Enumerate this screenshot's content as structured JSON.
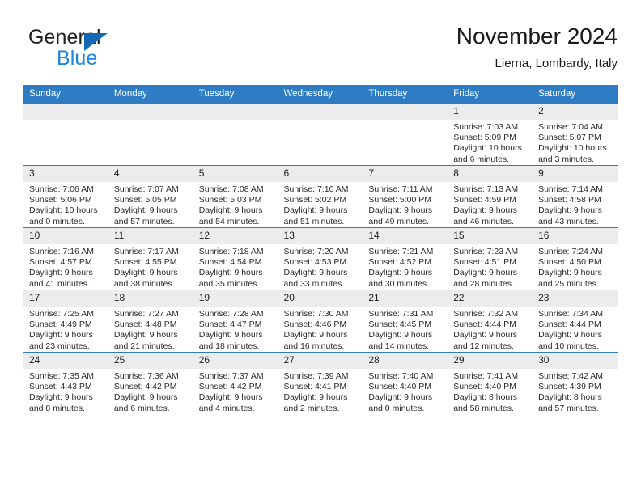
{
  "brand": {
    "name_part1": "General",
    "name_part2": "Blue",
    "logo_icon": "blue-triangle-flag-icon",
    "accent_color": "#1268b3",
    "secondary_color": "#1e87dd"
  },
  "header": {
    "title": "November 2024",
    "subtitle": "Lierna, Lombardy, Italy"
  },
  "theme": {
    "header_row_color": "#2e7cc3",
    "daynum_band_color": "#ececec",
    "text_color": "#2b2b2b"
  },
  "calendar": {
    "weekday_headers": [
      "Sunday",
      "Monday",
      "Tuesday",
      "Wednesday",
      "Thursday",
      "Friday",
      "Saturday"
    ],
    "weeks": [
      [
        {
          "day": "",
          "sunrise": "",
          "sunset": "",
          "daylight": ""
        },
        {
          "day": "",
          "sunrise": "",
          "sunset": "",
          "daylight": ""
        },
        {
          "day": "",
          "sunrise": "",
          "sunset": "",
          "daylight": ""
        },
        {
          "day": "",
          "sunrise": "",
          "sunset": "",
          "daylight": ""
        },
        {
          "day": "",
          "sunrise": "",
          "sunset": "",
          "daylight": ""
        },
        {
          "day": "1",
          "sunrise": "Sunrise: 7:03 AM",
          "sunset": "Sunset: 5:09 PM",
          "daylight": "Daylight: 10 hours and 6 minutes."
        },
        {
          "day": "2",
          "sunrise": "Sunrise: 7:04 AM",
          "sunset": "Sunset: 5:07 PM",
          "daylight": "Daylight: 10 hours and 3 minutes."
        }
      ],
      [
        {
          "day": "3",
          "sunrise": "Sunrise: 7:06 AM",
          "sunset": "Sunset: 5:06 PM",
          "daylight": "Daylight: 10 hours and 0 minutes."
        },
        {
          "day": "4",
          "sunrise": "Sunrise: 7:07 AM",
          "sunset": "Sunset: 5:05 PM",
          "daylight": "Daylight: 9 hours and 57 minutes."
        },
        {
          "day": "5",
          "sunrise": "Sunrise: 7:08 AM",
          "sunset": "Sunset: 5:03 PM",
          "daylight": "Daylight: 9 hours and 54 minutes."
        },
        {
          "day": "6",
          "sunrise": "Sunrise: 7:10 AM",
          "sunset": "Sunset: 5:02 PM",
          "daylight": "Daylight: 9 hours and 51 minutes."
        },
        {
          "day": "7",
          "sunrise": "Sunrise: 7:11 AM",
          "sunset": "Sunset: 5:00 PM",
          "daylight": "Daylight: 9 hours and 49 minutes."
        },
        {
          "day": "8",
          "sunrise": "Sunrise: 7:13 AM",
          "sunset": "Sunset: 4:59 PM",
          "daylight": "Daylight: 9 hours and 46 minutes."
        },
        {
          "day": "9",
          "sunrise": "Sunrise: 7:14 AM",
          "sunset": "Sunset: 4:58 PM",
          "daylight": "Daylight: 9 hours and 43 minutes."
        }
      ],
      [
        {
          "day": "10",
          "sunrise": "Sunrise: 7:16 AM",
          "sunset": "Sunset: 4:57 PM",
          "daylight": "Daylight: 9 hours and 41 minutes."
        },
        {
          "day": "11",
          "sunrise": "Sunrise: 7:17 AM",
          "sunset": "Sunset: 4:55 PM",
          "daylight": "Daylight: 9 hours and 38 minutes."
        },
        {
          "day": "12",
          "sunrise": "Sunrise: 7:18 AM",
          "sunset": "Sunset: 4:54 PM",
          "daylight": "Daylight: 9 hours and 35 minutes."
        },
        {
          "day": "13",
          "sunrise": "Sunrise: 7:20 AM",
          "sunset": "Sunset: 4:53 PM",
          "daylight": "Daylight: 9 hours and 33 minutes."
        },
        {
          "day": "14",
          "sunrise": "Sunrise: 7:21 AM",
          "sunset": "Sunset: 4:52 PM",
          "daylight": "Daylight: 9 hours and 30 minutes."
        },
        {
          "day": "15",
          "sunrise": "Sunrise: 7:23 AM",
          "sunset": "Sunset: 4:51 PM",
          "daylight": "Daylight: 9 hours and 28 minutes."
        },
        {
          "day": "16",
          "sunrise": "Sunrise: 7:24 AM",
          "sunset": "Sunset: 4:50 PM",
          "daylight": "Daylight: 9 hours and 25 minutes."
        }
      ],
      [
        {
          "day": "17",
          "sunrise": "Sunrise: 7:25 AM",
          "sunset": "Sunset: 4:49 PM",
          "daylight": "Daylight: 9 hours and 23 minutes."
        },
        {
          "day": "18",
          "sunrise": "Sunrise: 7:27 AM",
          "sunset": "Sunset: 4:48 PM",
          "daylight": "Daylight: 9 hours and 21 minutes."
        },
        {
          "day": "19",
          "sunrise": "Sunrise: 7:28 AM",
          "sunset": "Sunset: 4:47 PM",
          "daylight": "Daylight: 9 hours and 18 minutes."
        },
        {
          "day": "20",
          "sunrise": "Sunrise: 7:30 AM",
          "sunset": "Sunset: 4:46 PM",
          "daylight": "Daylight: 9 hours and 16 minutes."
        },
        {
          "day": "21",
          "sunrise": "Sunrise: 7:31 AM",
          "sunset": "Sunset: 4:45 PM",
          "daylight": "Daylight: 9 hours and 14 minutes."
        },
        {
          "day": "22",
          "sunrise": "Sunrise: 7:32 AM",
          "sunset": "Sunset: 4:44 PM",
          "daylight": "Daylight: 9 hours and 12 minutes."
        },
        {
          "day": "23",
          "sunrise": "Sunrise: 7:34 AM",
          "sunset": "Sunset: 4:44 PM",
          "daylight": "Daylight: 9 hours and 10 minutes."
        }
      ],
      [
        {
          "day": "24",
          "sunrise": "Sunrise: 7:35 AM",
          "sunset": "Sunset: 4:43 PM",
          "daylight": "Daylight: 9 hours and 8 minutes."
        },
        {
          "day": "25",
          "sunrise": "Sunrise: 7:36 AM",
          "sunset": "Sunset: 4:42 PM",
          "daylight": "Daylight: 9 hours and 6 minutes."
        },
        {
          "day": "26",
          "sunrise": "Sunrise: 7:37 AM",
          "sunset": "Sunset: 4:42 PM",
          "daylight": "Daylight: 9 hours and 4 minutes."
        },
        {
          "day": "27",
          "sunrise": "Sunrise: 7:39 AM",
          "sunset": "Sunset: 4:41 PM",
          "daylight": "Daylight: 9 hours and 2 minutes."
        },
        {
          "day": "28",
          "sunrise": "Sunrise: 7:40 AM",
          "sunset": "Sunset: 4:40 PM",
          "daylight": "Daylight: 9 hours and 0 minutes."
        },
        {
          "day": "29",
          "sunrise": "Sunrise: 7:41 AM",
          "sunset": "Sunset: 4:40 PM",
          "daylight": "Daylight: 8 hours and 58 minutes."
        },
        {
          "day": "30",
          "sunrise": "Sunrise: 7:42 AM",
          "sunset": "Sunset: 4:39 PM",
          "daylight": "Daylight: 8 hours and 57 minutes."
        }
      ]
    ]
  }
}
